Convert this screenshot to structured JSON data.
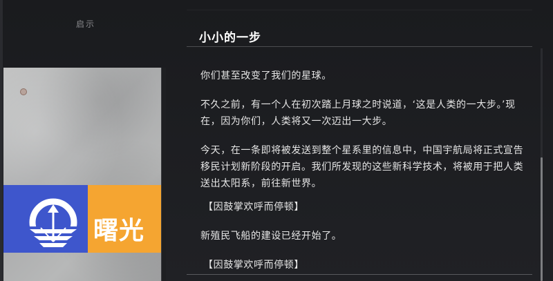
{
  "hint": {
    "label": "启示"
  },
  "card": {
    "logo_text": "曙光",
    "colors": {
      "blue": "#3e56cc",
      "orange": "#f5a531",
      "concrete": "#b3b4b4"
    },
    "emblem_icon": "rising-arrow-emblem-icon"
  },
  "article": {
    "title": "小小的一步",
    "paragraphs": [
      "你们甚至改变了我们的星球。",
      "不久之前，有一个人在初次踏上月球之时说道，‘这是人类的一大步。’现在，因为你们，人类将又一次迈出一大步。",
      "今天，在一条即将被发送到整个星系里的信息中，中国宇航局将正式宣告移民计划新阶段的开启。我们所发现的这些新科学技术，将被用于把人类送出太阳系，前往新世界。",
      "【因鼓掌欢呼而停顿】",
      "新殖民飞船的建设已经开始了。",
      "【因鼓掌欢呼而停顿】"
    ]
  },
  "scrollbar": {
    "position_fraction": 0.47
  }
}
